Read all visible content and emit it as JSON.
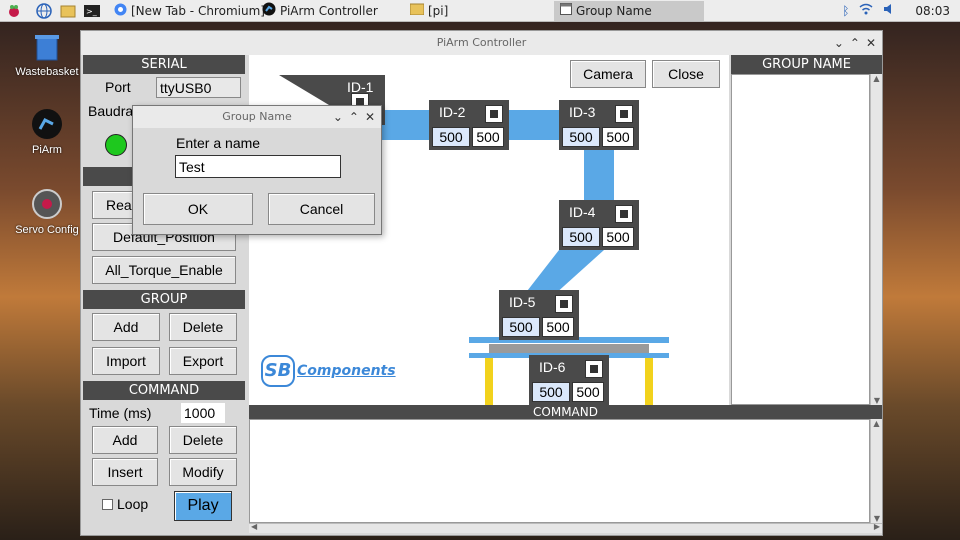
{
  "taskbar": {
    "tasks": [
      "[New Tab - Chromium]",
      "PiArm Controller",
      "[pi]",
      "Group Name"
    ],
    "clock": "08:03"
  },
  "desktop": {
    "icons": [
      "Wastebasket",
      "PiArm",
      "Servo Config"
    ]
  },
  "window": {
    "title": "PiArm Controller",
    "serial": {
      "header": "SERIAL",
      "port_label": "Port",
      "port_value": "ttyUSB0",
      "baud_label": "Baudra"
    },
    "buttons": {
      "read": "Rea",
      "default_position": "Default_Position",
      "all_torque": "All_Torque_Enable"
    },
    "group": {
      "header": "GROUP",
      "add": "Add",
      "delete": "Delete",
      "import": "Import",
      "export": "Export"
    },
    "command": {
      "header": "COMMAND",
      "time_label": "Time (ms)",
      "time_value": "1000",
      "add": "Add",
      "delete": "Delete",
      "insert": "Insert",
      "modify": "Modify",
      "loop": "Loop",
      "play": "Play"
    },
    "canvas": {
      "camera": "Camera",
      "close": "Close",
      "logo": "Components",
      "servos": [
        {
          "id": "ID-1",
          "v1": "",
          "v2": ""
        },
        {
          "id": "ID-2",
          "v1": "500",
          "v2": "500"
        },
        {
          "id": "ID-3",
          "v1": "500",
          "v2": "500"
        },
        {
          "id": "ID-4",
          "v1": "500",
          "v2": "500"
        },
        {
          "id": "ID-5",
          "v1": "500",
          "v2": "500"
        },
        {
          "id": "ID-6",
          "v1": "500",
          "v2": "500"
        }
      ]
    },
    "group_name_header": "GROUP NAME",
    "command_header": "COMMAND"
  },
  "dialog": {
    "title": "Group Name",
    "prompt": "Enter a name",
    "value": "Test",
    "ok": "OK",
    "cancel": "Cancel"
  },
  "colors": {
    "accent": "#5aa8e6",
    "play": "#5aa8e6",
    "status_green": "#1ec81e",
    "servo_dark": "#4a4a4a",
    "yellow": "#f2d21c"
  }
}
